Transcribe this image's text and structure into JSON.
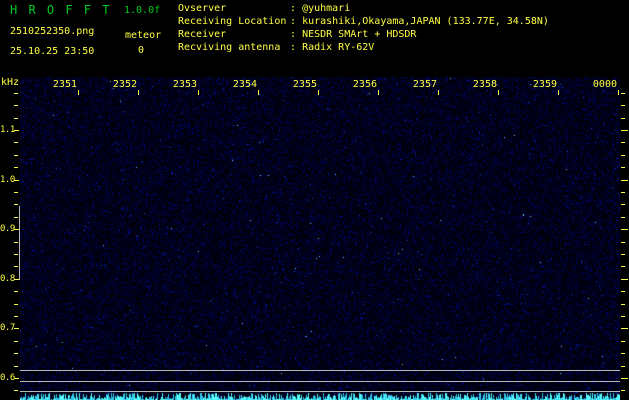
{
  "app": {
    "title": "H R O F F T",
    "version": "1.0.0f",
    "filename": "2510252350.png",
    "datetime": "25.10.25 23:50",
    "meteor_label": "meteor",
    "meteor_count": "0"
  },
  "info": {
    "rows": [
      {
        "label": "Ovserver",
        "sep": ":",
        "value": "@yuhmari"
      },
      {
        "label": "Receiving Location",
        "sep": ":",
        "value": "kurashiki,Okayama,JAPAN (133.77E, 34.58N)"
      },
      {
        "label": "Receiver",
        "sep": ":",
        "value": "NESDR SMArt + HDSDR"
      },
      {
        "label": "Recviving antenna",
        "sep": ":",
        "value": "Radix RY-62V"
      }
    ]
  },
  "spectrogram": {
    "freq_unit": "kHz",
    "time_labels": [
      "2351",
      "2352",
      "2353",
      "2354",
      "2355",
      "2356",
      "2357",
      "2358",
      "2359",
      "0000"
    ],
    "freq_labels": [
      "1.1",
      "1.0",
      "0.9",
      "0.8",
      "0.7",
      "0.6"
    ],
    "freq_range_khz": [
      0.6,
      1.1
    ],
    "minor_ticks_per_major": 4
  },
  "colors": {
    "background": "#000000",
    "text_yellow": "#ffff44",
    "text_green": "#00cc22",
    "grid_gray": "#b8b8b8",
    "bar_cyan": "#55ffff",
    "noise_blue": "#0000aa"
  }
}
